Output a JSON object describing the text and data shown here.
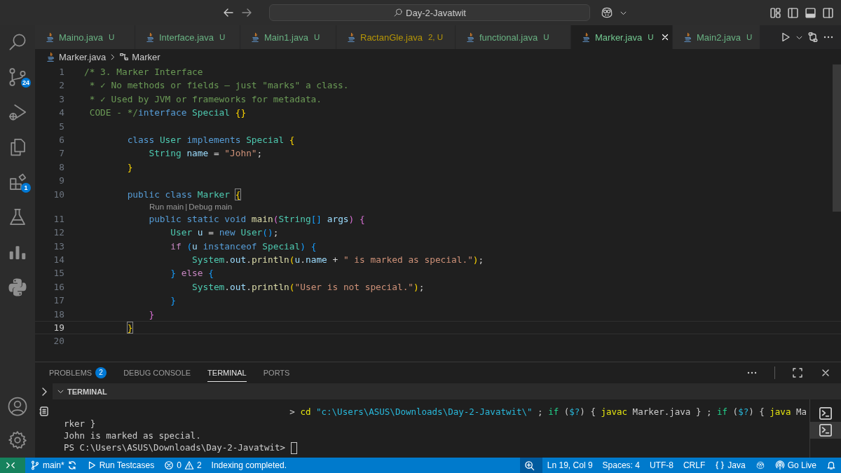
{
  "title_bar": {
    "search": "Day-2-Javatwit"
  },
  "activity_bar": {
    "top": [
      {
        "kind": "search"
      },
      {
        "kind": "source-control",
        "badge": "24"
      },
      {
        "kind": "run-debug"
      },
      {
        "kind": "explorer"
      },
      {
        "kind": "extensions",
        "badge": "1"
      },
      {
        "kind": "testing"
      },
      {
        "kind": "chart"
      },
      {
        "kind": "python"
      }
    ],
    "bottom": [
      {
        "kind": "account"
      },
      {
        "kind": "settings"
      }
    ]
  },
  "tabs": [
    {
      "label": "Maino.java",
      "status": "U",
      "kind": "untracked",
      "selected": false
    },
    {
      "label": "Interface.java",
      "status": "U",
      "kind": "untracked",
      "selected": false
    },
    {
      "label": "Main1.java",
      "status": "U",
      "kind": "untracked",
      "selected": false
    },
    {
      "label": "RactanGle.java",
      "status": "2, U",
      "kind": "warning",
      "selected": false
    },
    {
      "label": "functional.java",
      "status": "U",
      "kind": "untracked",
      "selected": false
    },
    {
      "label": "Marker.java",
      "status": "U",
      "kind": "untracked",
      "selected": true
    },
    {
      "label": "Main2.java",
      "status": "U",
      "kind": "untracked",
      "selected": false
    }
  ],
  "breadcrumb": {
    "file": "Marker.java",
    "symbol": "Marker"
  },
  "editor": {
    "lines": [
      {
        "kind": "code",
        "number": "1",
        "current": false,
        "tokens": [
          {
            "text": "/* 3. Marker Interface",
            "kind": "comment"
          }
        ]
      },
      {
        "kind": "code",
        "number": "2",
        "current": false,
        "tokens": [
          {
            "text": " * ✓ No methods or fields — just \"marks\" a class.",
            "kind": "comment"
          }
        ]
      },
      {
        "kind": "code",
        "number": "3",
        "current": false,
        "tokens": [
          {
            "text": " * ✓ Used by JVM or frameworks for metadata.",
            "kind": "comment"
          }
        ]
      },
      {
        "kind": "code",
        "number": "4",
        "current": false,
        "tokens": [
          {
            "text": " CODE - */",
            "kind": "comment"
          },
          {
            "text": "interface",
            "kind": "keyword"
          },
          {
            "text": " Special ",
            "kind": "type"
          },
          {
            "text": "{}",
            "kind": "brace1"
          }
        ]
      },
      {
        "kind": "code",
        "number": "5",
        "current": false
      },
      {
        "kind": "code",
        "number": "6",
        "current": false,
        "tokens": [
          {
            "text": "        class",
            "kind": "keyword"
          },
          {
            "text": " User ",
            "kind": "type"
          },
          {
            "text": "implements",
            "kind": "keyword"
          },
          {
            "text": " Special ",
            "kind": "type"
          },
          {
            "text": "{",
            "kind": "brace1"
          }
        ]
      },
      {
        "kind": "code",
        "number": "7",
        "current": false,
        "tokens": [
          {
            "text": "            String",
            "kind": "type"
          },
          {
            "text": " name",
            "kind": "variable"
          },
          {
            "text": " = ",
            "kind": "plain"
          },
          {
            "text": "\"John\"",
            "kind": "string"
          },
          {
            "text": ";",
            "kind": "plain"
          }
        ]
      },
      {
        "kind": "code",
        "number": "8",
        "current": false,
        "tokens": [
          {
            "text": "        }",
            "kind": "brace1"
          }
        ]
      },
      {
        "kind": "code",
        "number": "9",
        "current": false
      },
      {
        "kind": "code",
        "number": "10",
        "current": false,
        "tokens": [
          {
            "text": "        public class",
            "kind": "keyword"
          },
          {
            "text": " Marker ",
            "kind": "type"
          },
          {
            "text": "{",
            "kind": "match"
          }
        ]
      },
      {
        "kind": "codelens",
        "links": [
          "Run main",
          "Debug main"
        ],
        "separator": "|"
      },
      {
        "kind": "code",
        "number": "11",
        "current": false,
        "tokens": [
          {
            "text": "            public static void",
            "kind": "keyword"
          },
          {
            "text": " main",
            "kind": "function"
          },
          {
            "text": "(",
            "kind": "brace2"
          },
          {
            "text": "String",
            "kind": "type"
          },
          {
            "text": "[]",
            "kind": "brace3"
          },
          {
            "text": " args",
            "kind": "variable"
          },
          {
            "text": ")",
            "kind": "brace2"
          },
          {
            "text": " {",
            "kind": "brace2"
          }
        ]
      },
      {
        "kind": "code",
        "number": "12",
        "current": false,
        "tokens": [
          {
            "text": "                User",
            "kind": "type"
          },
          {
            "text": " u",
            "kind": "variable"
          },
          {
            "text": " = ",
            "kind": "plain"
          },
          {
            "text": "new",
            "kind": "keyword"
          },
          {
            "text": " User",
            "kind": "type"
          },
          {
            "text": "()",
            "kind": "brace3"
          },
          {
            "text": ";",
            "kind": "plain"
          }
        ]
      },
      {
        "kind": "code",
        "number": "13",
        "current": false,
        "tokens": [
          {
            "text": "                if",
            "kind": "control"
          },
          {
            "text": " (",
            "kind": "brace3"
          },
          {
            "text": "u",
            "kind": "variable"
          },
          {
            "text": " instanceof",
            "kind": "keyword"
          },
          {
            "text": " Special",
            "kind": "type"
          },
          {
            "text": ")",
            "kind": "brace3"
          },
          {
            "text": " {",
            "kind": "brace3"
          }
        ]
      },
      {
        "kind": "code",
        "number": "14",
        "current": false,
        "tokens": [
          {
            "text": "                    System",
            "kind": "type"
          },
          {
            "text": ".",
            "kind": "plain"
          },
          {
            "text": "out",
            "kind": "variable"
          },
          {
            "text": ".",
            "kind": "plain"
          },
          {
            "text": "println",
            "kind": "function"
          },
          {
            "text": "(",
            "kind": "brace1"
          },
          {
            "text": "u",
            "kind": "variable"
          },
          {
            "text": ".",
            "kind": "plain"
          },
          {
            "text": "name",
            "kind": "variable"
          },
          {
            "text": " + ",
            "kind": "plain"
          },
          {
            "text": "\" is marked as special.\"",
            "kind": "string"
          },
          {
            "text": ")",
            "kind": "brace1"
          },
          {
            "text": ";",
            "kind": "plain"
          }
        ]
      },
      {
        "kind": "code",
        "number": "15",
        "current": false,
        "tokens": [
          {
            "text": "                }",
            "kind": "brace3"
          },
          {
            "text": " else",
            "kind": "control"
          },
          {
            "text": " {",
            "kind": "brace3"
          }
        ]
      },
      {
        "kind": "code",
        "number": "16",
        "current": false,
        "tokens": [
          {
            "text": "                    System",
            "kind": "type"
          },
          {
            "text": ".",
            "kind": "plain"
          },
          {
            "text": "out",
            "kind": "variable"
          },
          {
            "text": ".",
            "kind": "plain"
          },
          {
            "text": "println",
            "kind": "function"
          },
          {
            "text": "(",
            "kind": "brace1"
          },
          {
            "text": "\"User is not special.\"",
            "kind": "string"
          },
          {
            "text": ")",
            "kind": "brace1"
          },
          {
            "text": ";",
            "kind": "plain"
          }
        ]
      },
      {
        "kind": "code",
        "number": "17",
        "current": false,
        "tokens": [
          {
            "text": "                }",
            "kind": "brace3"
          }
        ]
      },
      {
        "kind": "code",
        "number": "18",
        "current": false,
        "tokens": [
          {
            "text": "            }",
            "kind": "brace2"
          }
        ]
      },
      {
        "kind": "code",
        "number": "19",
        "current": true,
        "tokens": [
          {
            "text": "        }",
            "kind": "match"
          }
        ]
      },
      {
        "kind": "code",
        "number": "20",
        "current": false
      }
    ]
  },
  "panel": {
    "tabs": [
      {
        "label": "PROBLEMS",
        "badge": "2",
        "selected": false
      },
      {
        "label": "DEBUG CONSOLE",
        "selected": false
      },
      {
        "label": "TERMINAL",
        "selected": true
      },
      {
        "label": "PORTS",
        "selected": false
      }
    ],
    "section": "TERMINAL",
    "terminal": {
      "lines": [
        {
          "kind": "command",
          "tokens": [
            {
              "text": "> ",
              "kind": "plain"
            },
            {
              "text": "cd",
              "kind": "cmd"
            },
            {
              "text": " \"c:\\Users\\ASUS\\Downloads\\Day-2-Javatwit\\\"",
              "kind": "str"
            },
            {
              "text": " ; ",
              "kind": "plain"
            },
            {
              "text": "if",
              "kind": "kw"
            },
            {
              "text": " (",
              "kind": "plain"
            },
            {
              "text": "$?",
              "kind": "str"
            },
            {
              "text": ") { ",
              "kind": "plain"
            },
            {
              "text": "javac",
              "kind": "cmd"
            },
            {
              "text": " Marker.java } ; ",
              "kind": "plain"
            },
            {
              "text": "if",
              "kind": "kw"
            },
            {
              "text": " (",
              "kind": "plain"
            },
            {
              "text": "$?",
              "kind": "str"
            },
            {
              "text": ") { ",
              "kind": "plain"
            },
            {
              "text": "java",
              "kind": "cmd"
            },
            {
              "text": " Ma",
              "kind": "plain"
            }
          ]
        },
        {
          "kind": "output",
          "text": "rker }"
        },
        {
          "kind": "output",
          "text": "John is marked as special."
        },
        {
          "kind": "prompt",
          "text": "PS C:\\Users\\ASUS\\Downloads\\Day-2-Javatwit> "
        }
      ],
      "sessions": [
        {
          "selected": false
        },
        {
          "selected": true
        }
      ]
    }
  },
  "status_bar": {
    "branch": "main*",
    "run": "Run Testcases",
    "errors": "0",
    "warnings": "2",
    "message": "Indexing completed.",
    "position": "Ln 19, Col 9",
    "spaces": "Spaces: 4",
    "encoding": "UTF-8",
    "eol": "CRLF",
    "language": "Java",
    "live": "Go Live"
  }
}
